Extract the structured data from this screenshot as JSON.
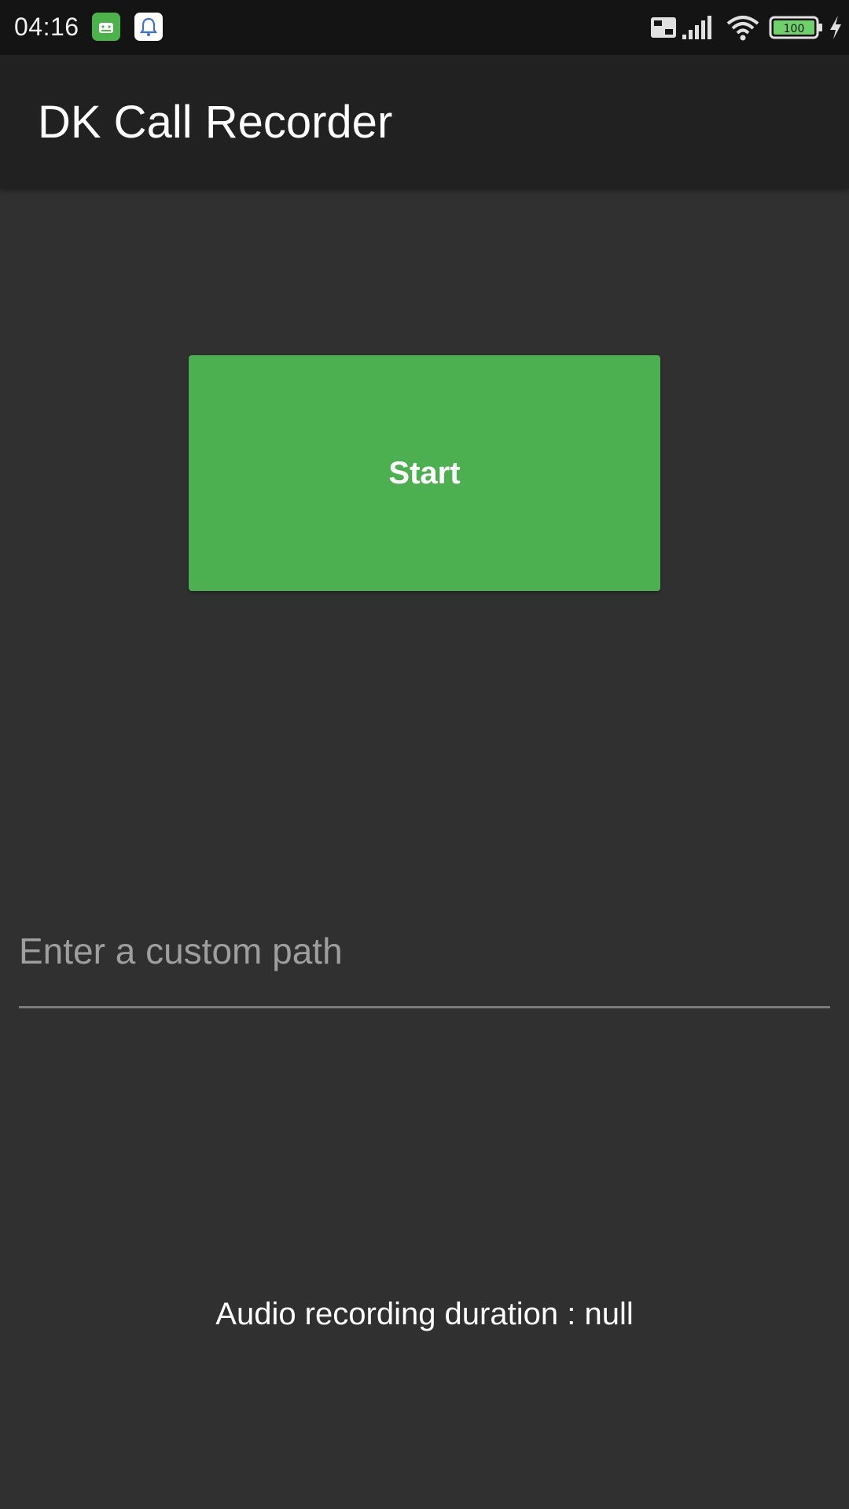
{
  "status_bar": {
    "time": "04:16",
    "notification_icons": [
      "android-app-icon",
      "bell-notification-icon"
    ],
    "indicators": [
      "volte-icon",
      "signal-icon",
      "wifi-icon",
      "battery-icon",
      "charging-icon"
    ],
    "battery_level": "100"
  },
  "app_bar": {
    "title": "DK Call Recorder"
  },
  "main": {
    "start_button_label": "Start",
    "path_input": {
      "placeholder": "Enter a custom path",
      "value": ""
    },
    "duration_text": "Audio recording duration : null"
  },
  "colors": {
    "background": "#303030",
    "app_bar": "#212121",
    "status_bar": "#141414",
    "accent_green": "#4caf50",
    "text_primary": "#ffffff",
    "text_hint": "#9e9e9e"
  }
}
